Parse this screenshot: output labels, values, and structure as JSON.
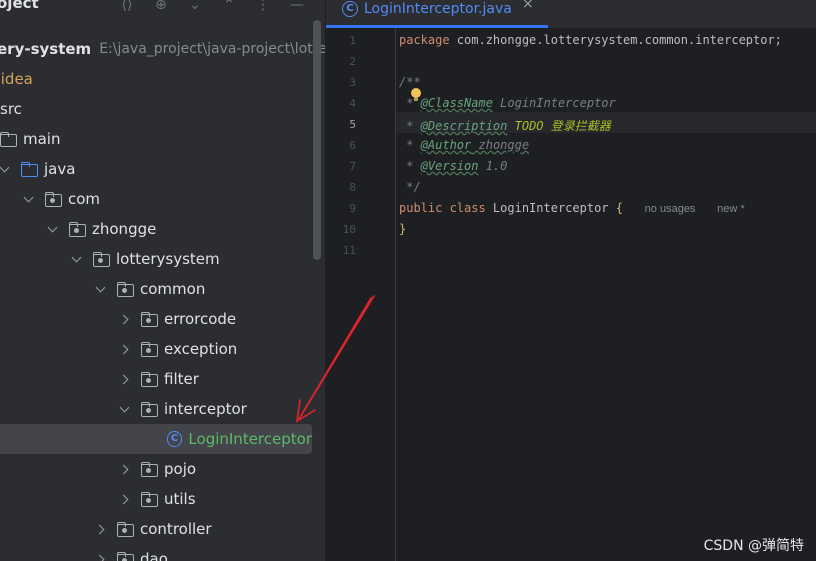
{
  "project_panel": {
    "title": "oject",
    "tree": [
      {
        "label": "ery-system",
        "path": "E:\\java_project\\java-project\\lottery-s",
        "type": "module"
      },
      {
        "label": ".idea",
        "type": "folder"
      },
      {
        "label": "src",
        "type": "folder"
      },
      {
        "label": "main",
        "type": "folder"
      },
      {
        "label": "java",
        "type": "source-folder"
      },
      {
        "label": "com",
        "type": "package"
      },
      {
        "label": "zhongge",
        "type": "package"
      },
      {
        "label": "lotterysystem",
        "type": "package"
      },
      {
        "label": "common",
        "type": "package"
      },
      {
        "label": "errorcode",
        "type": "package"
      },
      {
        "label": "exception",
        "type": "package"
      },
      {
        "label": "filter",
        "type": "package"
      },
      {
        "label": "interceptor",
        "type": "package"
      },
      {
        "label": "LoginInterceptor",
        "type": "class",
        "selected": true
      },
      {
        "label": "pojo",
        "type": "package"
      },
      {
        "label": "utils",
        "type": "package"
      },
      {
        "label": "controller",
        "type": "package"
      },
      {
        "label": "dao",
        "type": "package"
      }
    ]
  },
  "editor": {
    "tab": {
      "title": "LoginInterceptor.java",
      "icon": "class-icon",
      "close": "×",
      "icon_glyph": "C"
    },
    "current_line": "5",
    "line_numbers": [
      "1",
      "2",
      "3",
      "4",
      "5",
      "6",
      "7",
      "8",
      "9",
      "10",
      "11"
    ],
    "code": {
      "l1_kw": "package",
      "l1_rest": " com.zhongge.lotterysystem.common.interceptor;",
      "l3": "/**",
      "l4_star": " * ",
      "l4_tag": "@ClassName",
      "l4_val": " LoginInterceptor",
      "l5_star": " * ",
      "l5_tag": "@Description",
      "l5_todo": " TODO ",
      "l5_cn": "登录拦截器",
      "l6_star": " * ",
      "l6_tag": "@Author",
      "l6_val": " zhongge",
      "l7_star": " * ",
      "l7_tag": "@Version",
      "l7_val": " 1.0",
      "l8": " */",
      "l9_kw": "public class",
      "l9_name": " LoginInterceptor ",
      "l9_brace": "{",
      "l9_hint1": "no usages",
      "l9_hint2": "new *",
      "l10_brace": "}"
    }
  },
  "watermark": "CSDN @弹简特",
  "colors": {
    "accent": "#3574f0",
    "class_label": "#5fb865",
    "keyword": "#cf8e6d",
    "annotation_arrow": "#e0242b"
  }
}
